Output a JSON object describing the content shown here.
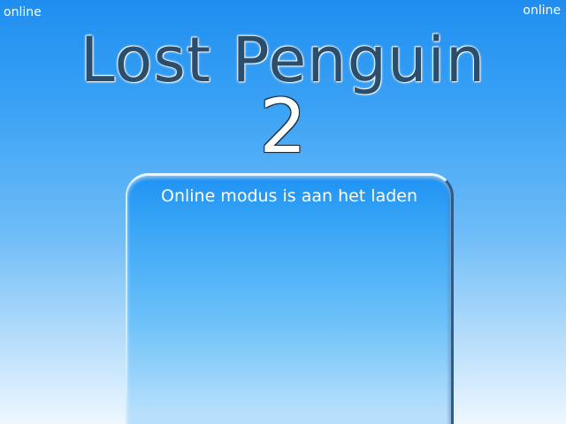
{
  "corner": {
    "left_label": "online",
    "right_label": "online"
  },
  "title": {
    "main": "Lost Penguin",
    "number": "2"
  },
  "panel": {
    "status_text": "Online modus is aan het laden"
  },
  "colors": {
    "sky_top": "#1f8ef0",
    "sky_bottom": "#eef7ff",
    "title_text": "#2a4e6c",
    "panel_top": "#1f93f3"
  }
}
